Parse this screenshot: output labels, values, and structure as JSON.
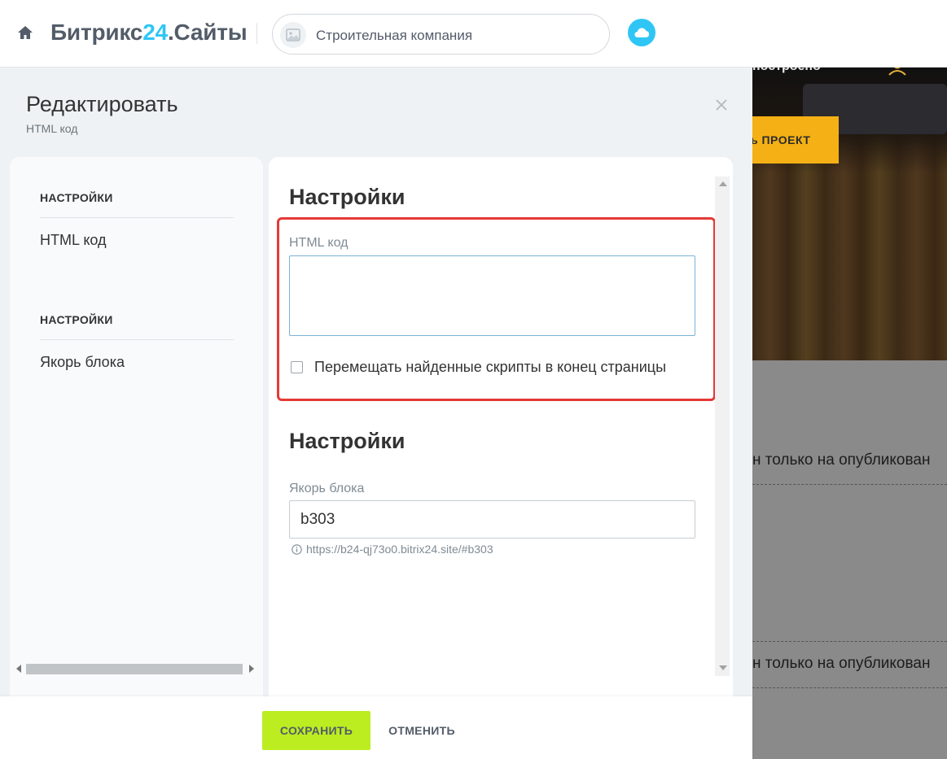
{
  "topbar": {
    "brand_prefix": "Битрикс",
    "brand_accent": "24",
    "brand_suffix": ".Сайты",
    "site_name": "Строительная компания",
    "home_icon": "home-icon",
    "site_thumb_icon": "image-icon",
    "cloud_icon": "cloud-icon",
    "accent_color": "#2fc6f6"
  },
  "preview": {
    "top_text": "построено",
    "cta_label": "ь ПРОЕКТ",
    "notice_1": "н только на опубликован",
    "notice_2": "н только на опубликован"
  },
  "panel": {
    "title": "Редактировать",
    "subtitle": "HTML код",
    "close_icon": "close-icon"
  },
  "nav": {
    "sections": [
      {
        "heading": "НАСТРОЙКИ",
        "item": "HTML код"
      },
      {
        "heading": "НАСТРОЙКИ",
        "item": "Якорь блока"
      }
    ]
  },
  "content": {
    "section1": {
      "title": "Настройки",
      "field_label": "HTML код",
      "textarea_value": "",
      "checkbox_label": "Перемещать найденные скрипты в конец страницы",
      "checkbox_checked": false
    },
    "section2": {
      "title": "Настройки",
      "field_label": "Якорь блока",
      "anchor_value": "b303",
      "anchor_hint": "https://b24-qj73o0.bitrix24.site/#b303",
      "hint_icon": "info-icon"
    },
    "highlight_color": "#e53935"
  },
  "footer": {
    "save_label": "СОХРАНИТЬ",
    "cancel_label": "ОТМЕНИТЬ",
    "save_color": "#bbed21"
  }
}
